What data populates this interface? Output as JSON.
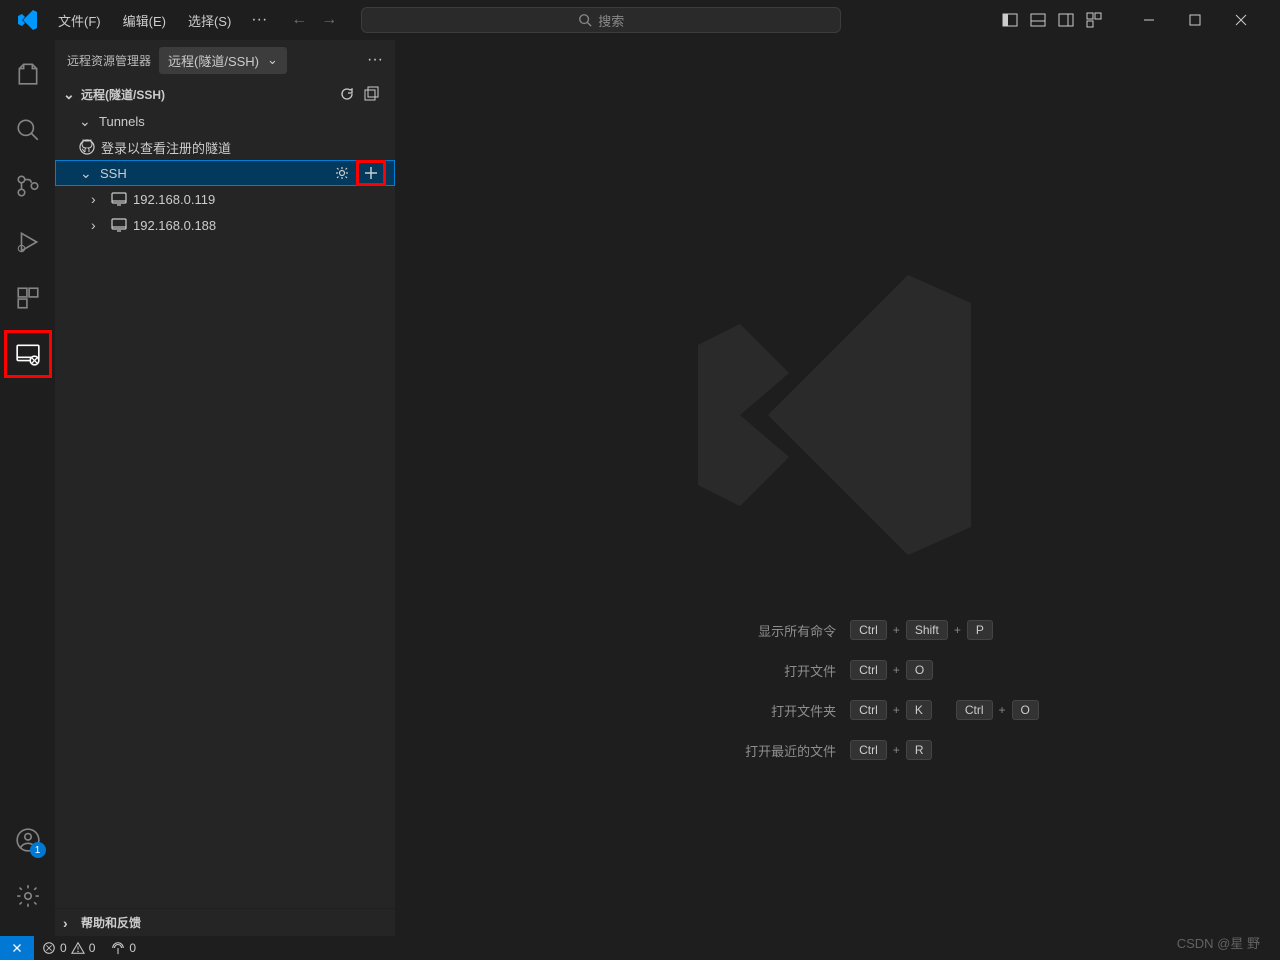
{
  "menu": {
    "file": "文件(F)",
    "edit": "编辑(E)",
    "select": "选择(S)"
  },
  "search": {
    "placeholder": "搜索"
  },
  "sidebar": {
    "title": "远程资源管理器",
    "dropdown": "远程(隧道/SSH)",
    "section_header": "远程(隧道/SSH)",
    "tunnels": "Tunnels",
    "login_hint": "登录以查看注册的隧道",
    "ssh": "SSH",
    "hosts": [
      "192.168.0.119",
      "192.168.0.188"
    ],
    "help": "帮助和反馈"
  },
  "account_badge": "1",
  "shortcuts": {
    "show_all": "显示所有命令",
    "open_file": "打开文件",
    "open_folder": "打开文件夹",
    "open_recent": "打开最近的文件",
    "keys": {
      "ctrl": "Ctrl",
      "shift": "Shift",
      "p": "P",
      "o": "O",
      "k": "K",
      "r": "R",
      "plus": "+"
    }
  },
  "statusbar": {
    "errors": "0",
    "warnings": "0",
    "ports": "0"
  },
  "watermark": "CSDN @星 野"
}
